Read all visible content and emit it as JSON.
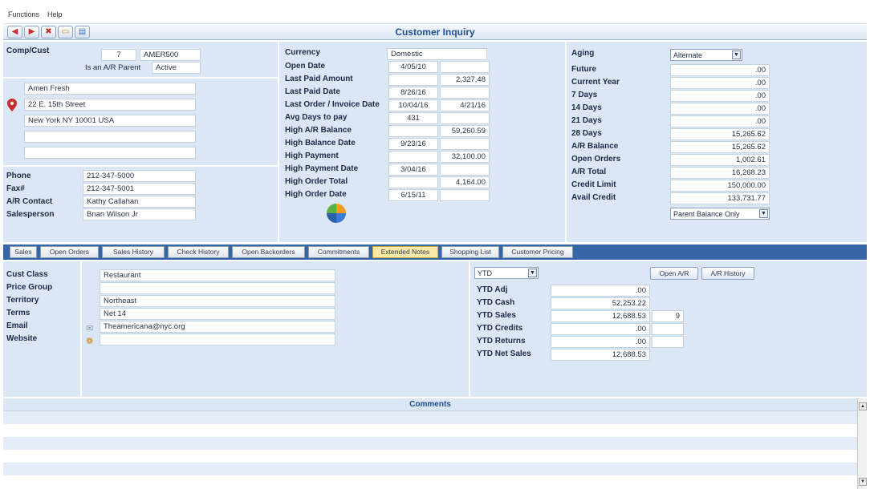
{
  "menu": {
    "functions": "Functions",
    "help": "Help"
  },
  "window": {
    "title": "Customer Inquiry"
  },
  "icons": {
    "back": "◀",
    "forward": "▶",
    "cancel": "✖",
    "folder": "▭",
    "print": "▤",
    "map_pin": "●",
    "mail": "✉",
    "web": "❁",
    "dropdown": "▼",
    "scroll_up": "▲",
    "scroll_down": "▼"
  },
  "colors": {
    "accent": "#1e4e98",
    "tabstrip": "#3566a5",
    "panel": "#dbe7f5",
    "active_tab": "#fbeaa7",
    "pin": "#c62a2a"
  },
  "customer": {
    "comp_cust_label": "Comp/Cust",
    "comp": "7",
    "cust": "AMER500",
    "ar_parent": "Is an A/R Parent",
    "status": "Active",
    "address": [
      "Amen Fresh",
      "22 E. 15th Street",
      "New York NY 10001 USA",
      "",
      ""
    ],
    "contact": [
      {
        "label": "Phone",
        "value": "212-347-5000"
      },
      {
        "label": "Fax#",
        "value": "212-347-5001"
      },
      {
        "label": "A/R Contact",
        "value": "Kathy Callahan"
      },
      {
        "label": "Salesperson",
        "value": "Bnan Wilson Jr"
      }
    ]
  },
  "account": {
    "currency_label": "Currency",
    "currency": "Domestic",
    "rows": [
      {
        "label": "Open Date",
        "date": "4/05/10",
        "amount": ""
      },
      {
        "label": "Last Paid Amount",
        "date": "",
        "amount": "2,327.48"
      },
      {
        "label": "Last Paid Date",
        "date": "8/26/16",
        "amount": ""
      },
      {
        "label": "Last Order / Invoice Date",
        "date": "10/04/16",
        "amount": "4/21/16"
      },
      {
        "label": "Avg Days to pay",
        "date": "431",
        "amount": ""
      },
      {
        "label": "High A/R Balance",
        "date": "",
        "amount": "59,260.59"
      },
      {
        "label": "High Balance Date",
        "date": "9/23/16",
        "amount": ""
      },
      {
        "label": "High Payment",
        "date": "",
        "amount": "32,100.00"
      },
      {
        "label": "High Payment Date",
        "date": "3/04/16",
        "amount": ""
      },
      {
        "label": "High Order Total",
        "date": "",
        "amount": "4,164.00"
      },
      {
        "label": "High Order Date",
        "date": "6/15/11",
        "amount": ""
      }
    ]
  },
  "aging": {
    "label": "Aging",
    "mode": "Alternate",
    "rows": [
      {
        "label": "Future",
        "value": ".00"
      },
      {
        "label": "Current Year",
        "value": ".00"
      },
      {
        "label": "7 Days",
        "value": ".00"
      },
      {
        "label": "14 Days",
        "value": ".00"
      },
      {
        "label": "21 Days",
        "value": ".00"
      },
      {
        "label": "28 Days",
        "value": "15,265.62"
      },
      {
        "label": "A/R Balance",
        "value": "15,265.62"
      },
      {
        "label": "Open Orders",
        "value": "1,002.61"
      },
      {
        "label": "A/R Total",
        "value": "16,268.23"
      },
      {
        "label": "Credit Limit",
        "value": "150,000.00"
      },
      {
        "label": "Avail Credit",
        "value": "133,731.77"
      }
    ],
    "balance_mode": "Parent Balance Only"
  },
  "tabs": [
    "Sales",
    "Open Orders",
    "Sales History",
    "Check History",
    "Open Backorders",
    "Commitments",
    "Extended Notes",
    "Shopping List",
    "Customer Pricing"
  ],
  "active_tab": "Extended Notes",
  "details": {
    "rows": [
      {
        "label": "Cust Class",
        "value": "Restaurant"
      },
      {
        "label": "Price Group",
        "value": ""
      },
      {
        "label": "Territory",
        "value": "Northeast"
      },
      {
        "label": "Terms",
        "value": "Net 14"
      },
      {
        "label": "Email",
        "value": "Theamericana@nyc.org"
      },
      {
        "label": "Website",
        "value": ""
      }
    ]
  },
  "ytd": {
    "period": "YTD",
    "open_ar_label": "Open A/R",
    "ar_history_label": "A/R History",
    "rows": [
      {
        "label": "YTD Adj",
        "value": ".00",
        "extra": null
      },
      {
        "label": "YTD Cash",
        "value": "52,253.22",
        "extra": null
      },
      {
        "label": "YTD Sales",
        "value": "12,688.53",
        "extra": "9"
      },
      {
        "label": "YTD Credits",
        "value": ".00",
        "extra": ""
      },
      {
        "label": "YTD Returns",
        "value": ".00",
        "extra": ""
      },
      {
        "label": "YTD Net Sales",
        "value": "12,688.53",
        "extra": null
      }
    ]
  },
  "comments": {
    "title": "Comments"
  }
}
